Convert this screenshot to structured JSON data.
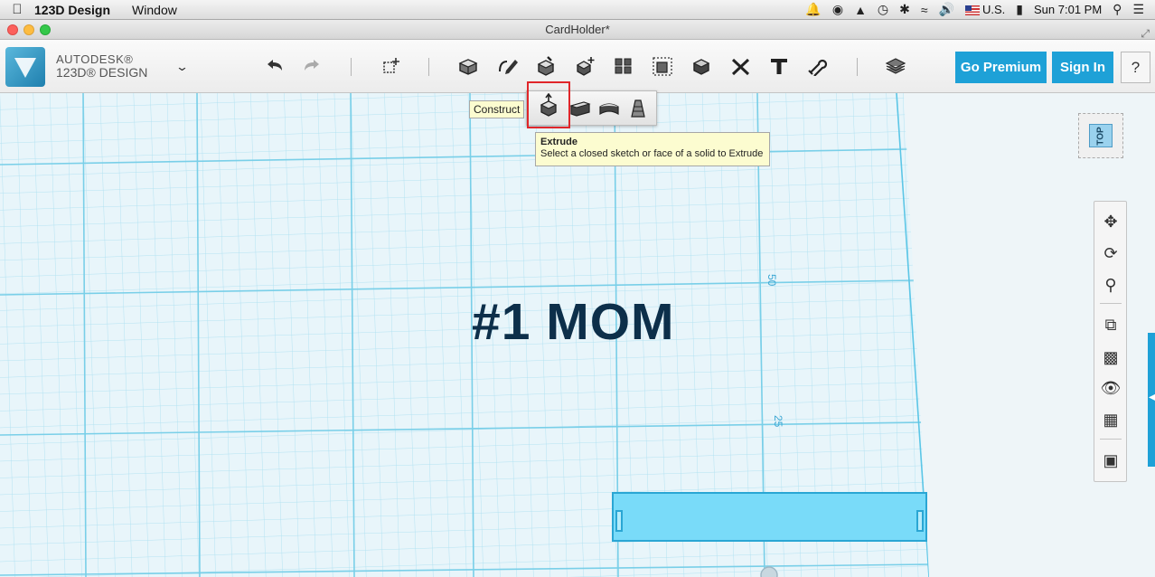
{
  "menubar": {
    "app_name": "123D Design",
    "menus": [
      "Window"
    ],
    "input_source": "U.S.",
    "clock": "Sun 7:01 PM"
  },
  "window": {
    "title": "CardHolder*"
  },
  "brand": {
    "company": "AUTODESK®",
    "product": "123D® DESIGN"
  },
  "toolbar": {
    "premium_label": "Go Premium",
    "signin_label": "Sign In",
    "help_label": "?",
    "icons": [
      "undo-icon",
      "redo-icon",
      "transform-icon",
      "primitives-icon",
      "sketch-icon",
      "construct-icon",
      "modify-icon",
      "pattern-icon",
      "group-icon",
      "combine-icon",
      "measure-icon",
      "text-icon",
      "snap-icon",
      "material-icon"
    ]
  },
  "construct_menu": {
    "tooltip_label": "Construct",
    "items": [
      "extrude",
      "sweep",
      "revolve",
      "loft"
    ]
  },
  "extrude_tooltip": {
    "title": "Extrude",
    "description": "Select a closed sketch or face of a solid to Extrude"
  },
  "viewport": {
    "model_text": "#1 MOM",
    "grid_labels": [
      "50",
      "25"
    ],
    "grid_color": "#5cc6e6",
    "model_color": "#0d2f4a"
  },
  "viewcube": {
    "face_label": "TOP"
  },
  "navigation": {
    "buttons": [
      "pan",
      "orbit",
      "zoom",
      "fit",
      "view-mode",
      "visibility",
      "grid-materials",
      "edit-grid"
    ]
  },
  "colors": {
    "accent": "#1ea1d7",
    "selection_outline": "#e0262a",
    "tooltip_bg": "#fcfcd0"
  }
}
